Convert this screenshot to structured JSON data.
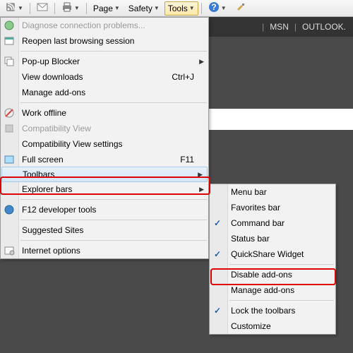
{
  "toolbar": {
    "page_label": "Page",
    "safety_label": "Safety",
    "tools_label": "Tools"
  },
  "header": {
    "link1": "MSN",
    "link2": "OUTLOOK."
  },
  "menu": {
    "diagnose": "Diagnose connection problems...",
    "reopen": "Reopen last browsing session",
    "popup": "Pop-up Blocker",
    "downloads": "View downloads",
    "downloads_key": "Ctrl+J",
    "manage": "Manage add-ons",
    "offline": "Work offline",
    "compat": "Compatibility View",
    "compat_settings": "Compatibility View settings",
    "fullscreen": "Full screen",
    "fullscreen_key": "F11",
    "toolbars": "Toolbars",
    "explorer": "Explorer bars",
    "f12": "F12 developer tools",
    "suggested": "Suggested Sites",
    "options": "Internet options"
  },
  "submenu": {
    "menubar": "Menu bar",
    "favorites": "Favorites bar",
    "command": "Command bar",
    "status": "Status bar",
    "quickshare": "QuickShare Widget",
    "disable": "Disable add-ons",
    "manage": "Manage add-ons",
    "lock": "Lock the toolbars",
    "customize": "Customize"
  }
}
